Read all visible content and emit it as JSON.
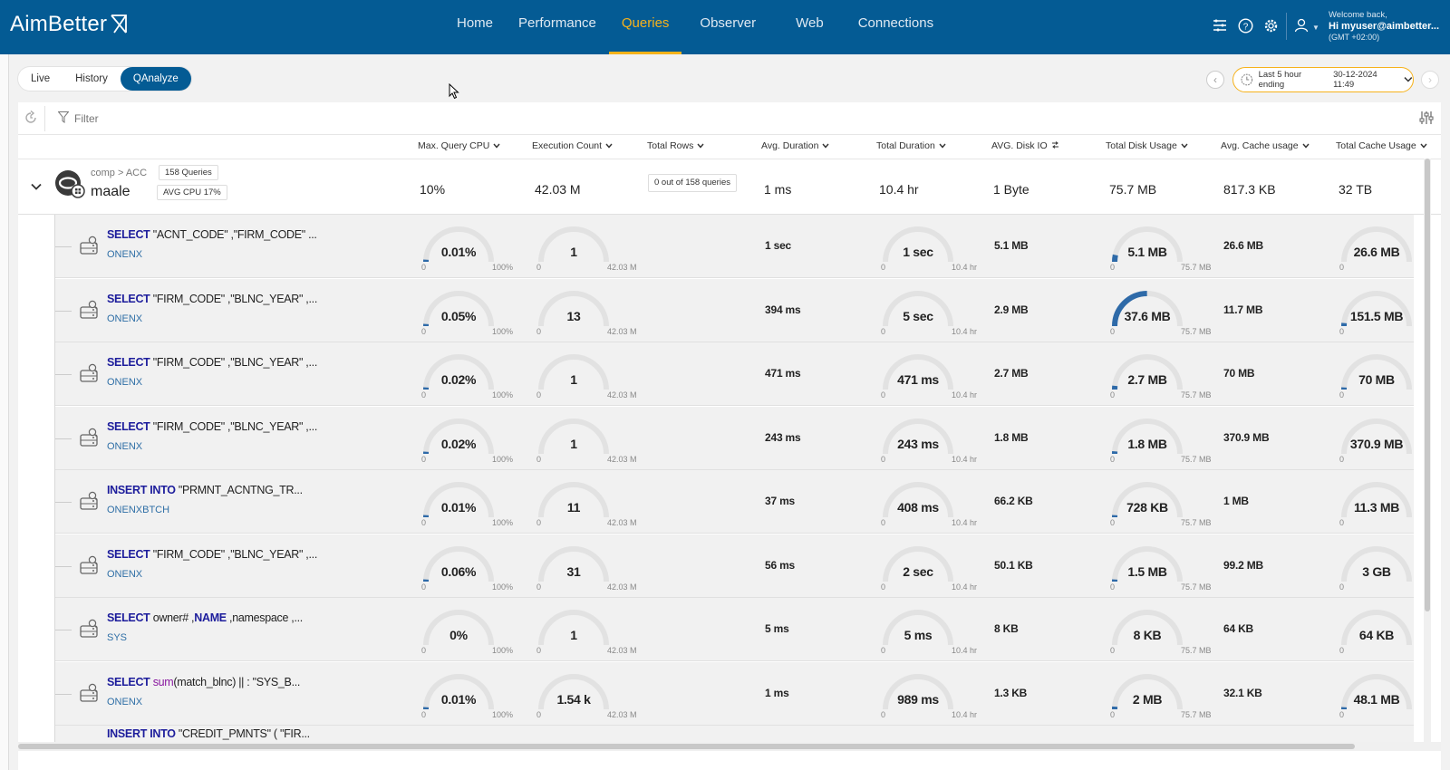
{
  "app": {
    "logo_text": "AimBetter"
  },
  "nav": [
    {
      "label": "Home",
      "active": false
    },
    {
      "label": "Performance",
      "active": false
    },
    {
      "label": "Queries",
      "active": true
    },
    {
      "label": "Observer",
      "active": false
    },
    {
      "label": "Web",
      "active": false
    },
    {
      "label": "Connections",
      "active": false
    }
  ],
  "user": {
    "welcome": "Welcome back,",
    "name": "Hi myuser@aimbetter...",
    "timezone": "(GMT +02:00)"
  },
  "tabs": [
    {
      "label": "Live",
      "active": false
    },
    {
      "label": "History",
      "active": false
    },
    {
      "label": "QAnalyze",
      "active": true
    }
  ],
  "time_range": {
    "label": "Last 5 hour ending",
    "value": "30-12-2024 11:49"
  },
  "filter": {
    "placeholder": "Filter"
  },
  "columns": [
    "Max. Query CPU",
    "Execution Count",
    "Total Rows",
    "Avg. Duration",
    "Total Duration",
    "AVG. Disk IO",
    "Total Disk Usage",
    "Avg. Cache usage",
    "Total Cache Usage"
  ],
  "group": {
    "path": "comp > ACC",
    "name": "maale",
    "queries_badge": "158 Queries",
    "cpu_badge": "AVG CPU 17%",
    "max_cpu": "10%",
    "exec_count": "42.03 M",
    "total_rows_badge": "0 out of 158 queries",
    "avg_duration": "1 ms",
    "total_duration": "10.4 hr",
    "avg_disk_io": "1 Byte",
    "total_disk": "75.7 MB",
    "avg_cache": "817.3 KB",
    "total_cache": "32 TB"
  },
  "gauge_ranges": {
    "cpu": {
      "min": "0",
      "max": "100%"
    },
    "exec": {
      "min": "0",
      "max": "42.03 M"
    },
    "duration": {
      "min": "0",
      "max": "10.4 hr"
    },
    "disk": {
      "min": "0",
      "max": "75.7 MB"
    },
    "cache": {
      "min": "0"
    }
  },
  "rows": [
    {
      "kw1": "SELECT",
      "text": " \"ACNT_CODE\" ,\"FIRM_CODE\" ...",
      "schema": "ONENX",
      "cpu": "0.01%",
      "cpu_frac": 0.0001,
      "exec": "1",
      "exec_frac": 0.0,
      "avg_dur": "1 sec",
      "tot_dur": "1 sec",
      "dur_frac": 0.0,
      "avg_io": "5.1 MB",
      "disk": "5.1 MB",
      "disk_frac": 0.067,
      "avg_cache": "26.6 MB",
      "cache": "26.6 MB",
      "cache_frac": 0.0
    },
    {
      "kw1": "SELECT",
      "text": " \"FIRM_CODE\" ,\"BLNC_YEAR\" ,...",
      "schema": "ONENX",
      "cpu": "0.05%",
      "cpu_frac": 0.0005,
      "exec": "13",
      "exec_frac": 0.0,
      "avg_dur": "394 ms",
      "tot_dur": "5 sec",
      "dur_frac": 0.0,
      "avg_io": "2.9 MB",
      "disk": "37.6 MB",
      "disk_frac": 0.497,
      "avg_cache": "11.7 MB",
      "cache": "151.5 MB",
      "cache_frac": 0.03
    },
    {
      "kw1": "SELECT",
      "text": " \"FIRM_CODE\" ,\"BLNC_YEAR\" ,...",
      "schema": "ONENX",
      "cpu": "0.02%",
      "cpu_frac": 0.0002,
      "exec": "1",
      "exec_frac": 0.0,
      "avg_dur": "471 ms",
      "tot_dur": "471 ms",
      "dur_frac": 0.0,
      "avg_io": "2.7 MB",
      "disk": "2.7 MB",
      "disk_frac": 0.036,
      "avg_cache": "70 MB",
      "cache": "70 MB",
      "cache_frac": 0.02
    },
    {
      "kw1": "SELECT",
      "text": " \"FIRM_CODE\" ,\"BLNC_YEAR\" ,...",
      "schema": "ONENX",
      "cpu": "0.02%",
      "cpu_frac": 0.0002,
      "exec": "1",
      "exec_frac": 0.0,
      "avg_dur": "243 ms",
      "tot_dur": "243 ms",
      "dur_frac": 0.0,
      "avg_io": "1.8 MB",
      "disk": "1.8 MB",
      "disk_frac": 0.024,
      "avg_cache": "370.9 MB",
      "cache": "370.9 MB",
      "cache_frac": 0.0
    },
    {
      "kw1": "INSERT INTO",
      "text": " \"PRMNT_ACNTNG_TR...",
      "schema": "ONENXBTCH",
      "cpu": "0.01%",
      "cpu_frac": 0.0001,
      "exec": "11",
      "exec_frac": 0.0,
      "avg_dur": "37 ms",
      "tot_dur": "408 ms",
      "dur_frac": 0.0,
      "avg_io": "66.2 KB",
      "disk": "728 KB",
      "disk_frac": 0.01,
      "avg_cache": "1 MB",
      "cache": "11.3 MB",
      "cache_frac": 0.0
    },
    {
      "kw1": "SELECT",
      "text": " \"FIRM_CODE\" ,\"BLNC_YEAR\" ,...",
      "schema": "ONENX",
      "cpu": "0.06%",
      "cpu_frac": 0.0006,
      "exec": "31",
      "exec_frac": 0.0,
      "avg_dur": "56 ms",
      "tot_dur": "2 sec",
      "dur_frac": 0.0,
      "avg_io": "50.1 KB",
      "disk": "1.5 MB",
      "disk_frac": 0.02,
      "avg_cache": "99.2 MB",
      "cache": "3 GB",
      "cache_frac": 0.0
    },
    {
      "kw1": "SELECT",
      "text": " owner# ,",
      "kw2": "NAME",
      "text2": " ,namespace ,...",
      "schema": "SYS",
      "cpu": "0%",
      "cpu_frac": 0.0,
      "exec": "1",
      "exec_frac": 0.0,
      "avg_dur": "5 ms",
      "tot_dur": "5 ms",
      "dur_frac": 0.0,
      "avg_io": "8 KB",
      "disk": "8 KB",
      "disk_frac": 0.0,
      "avg_cache": "64 KB",
      "cache": "64 KB",
      "cache_frac": 0.0
    },
    {
      "kw1": "SELECT",
      "fn": " sum",
      "text": "(match_blnc) || : \"SYS_B...",
      "schema": "ONENX",
      "cpu": "0.01%",
      "cpu_frac": 0.0001,
      "exec": "1.54 k",
      "exec_frac": 0.0,
      "avg_dur": "1 ms",
      "tot_dur": "989 ms",
      "dur_frac": 0.0,
      "avg_io": "1.3 KB",
      "disk": "2 MB",
      "disk_frac": 0.026,
      "avg_cache": "32.1 KB",
      "cache": "48.1 MB",
      "cache_frac": 0.02
    }
  ],
  "partial_row": {
    "kw1": "INSERT INTO",
    "text": " \"CREDIT_PMNTS\" ( \"FIR..."
  }
}
